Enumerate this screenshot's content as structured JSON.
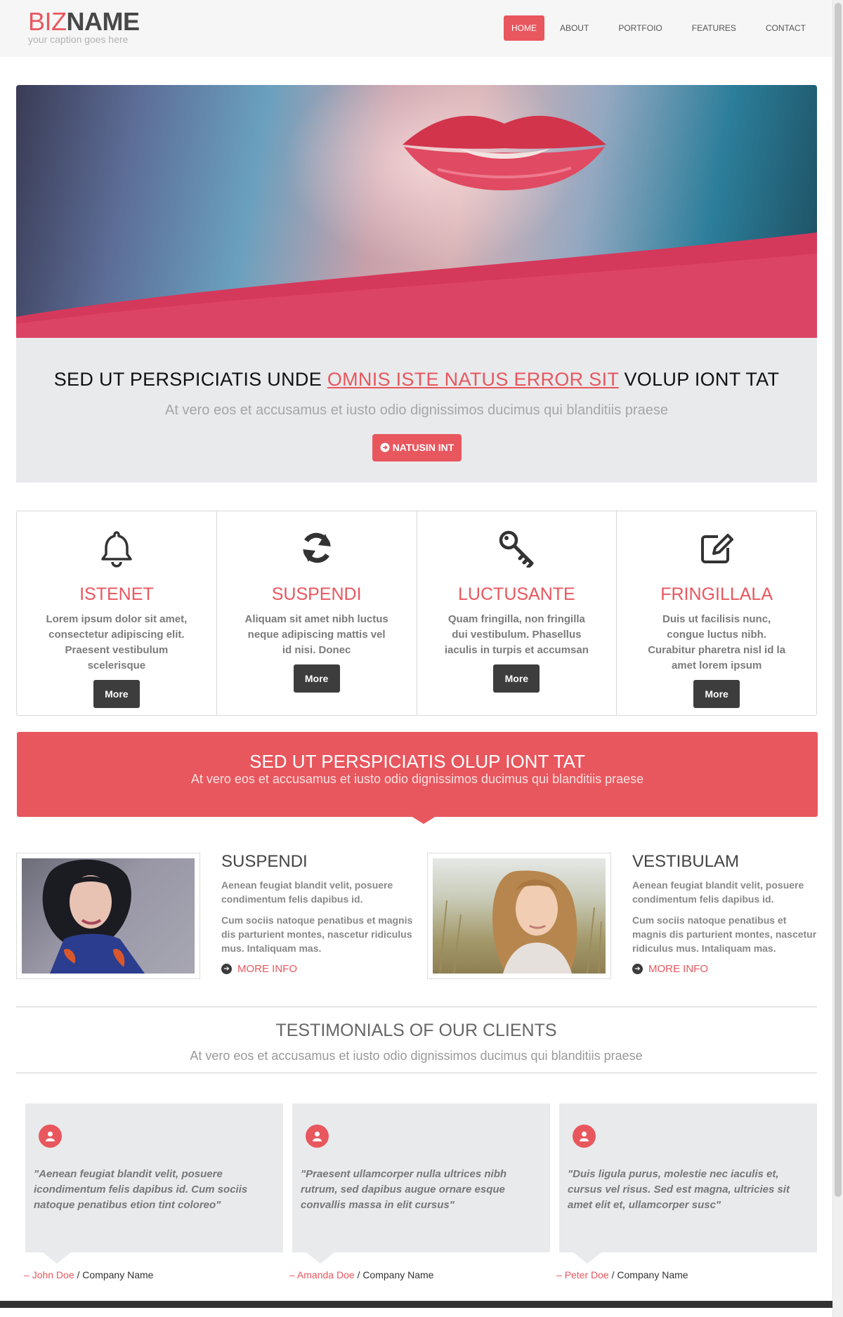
{
  "brand": {
    "logo_part1": "BIZ",
    "logo_part2": "NAME",
    "caption": "your caption goes here"
  },
  "nav": {
    "items": [
      "HOME",
      "ABOUT",
      "PORTFOIO",
      "FEATURES",
      "CONTACT"
    ],
    "active": "HOME"
  },
  "intro": {
    "headline_pre": "SED UT PERSPICIATIS UNDE",
    "headline_highlight": "OMNIS ISTE NATUS ERROR SIT",
    "headline_post": "VOLUP IONT TAT",
    "subtitle": "At vero eos et accusamus et iusto odio dignissimos ducimus qui blanditiis praese",
    "button_icon": "circle-arrow-right-icon",
    "button_label": "NATUSIN INT"
  },
  "features": [
    {
      "icon": "bell-icon",
      "title": "ISTENET",
      "text": "Lorem ipsum dolor sit amet, consectetur adipiscing elit. Praesent vestibulum scelerisque",
      "button": "More"
    },
    {
      "icon": "refresh-icon",
      "title": "SUSPENDI",
      "text": "Aliquam sit amet nibh luctus neque adipiscing mattis vel id nisi. Donec",
      "button": "More"
    },
    {
      "icon": "key-icon",
      "title": "LUCTUSANTE",
      "text": "Quam fringilla, non fringilla dui vestibulum. Phasellus iaculis in turpis et accumsan",
      "button": "More"
    },
    {
      "icon": "edit-icon",
      "title": "FRINGILLALA",
      "text": "Duis ut facilisis nunc, congue luctus nibh. Curabitur pharetra nisl id la amet lorem ipsum",
      "button": "More"
    }
  ],
  "banner": {
    "title": "SED UT PERSPICIATIS OLUP IONT TAT",
    "subtitle": "At vero eos et accusamus et iusto odio dignissimos ducimus qui blanditiis praese"
  },
  "profiles": [
    {
      "title": "SUSPENDI",
      "para1": "Aenean feugiat blandit velit, posuere condimentum felis dapibus id.",
      "para2": "Cum sociis natoque penatibus et magnis dis parturient montes, nascetur ridiculus mus. Intaliquam mas.",
      "link": "MORE INFO"
    },
    {
      "title": "VESTIBULAM",
      "para1": "Aenean feugiat blandit velit, posuere condimentum felis dapibus id.",
      "para2": "Cum sociis natoque penatibus et magnis dis parturient montes, nascetur ridiculus mus. Intaliquam mas.",
      "link": "MORE INFO"
    }
  ],
  "testimonials": {
    "title": "TESTIMONIALS OF OUR CLIENTS",
    "subtitle": "At vero eos et accusamus et iusto odio dignissimos ducimus qui blanditiis praese",
    "items": [
      {
        "quote": "\"Aenean feugiat blandit velit, posuere icondimentum felis dapibus id. Cum sociis natoque penatibus etion tint coloreo\"",
        "dash": "–",
        "name": "John Doe",
        "sep": "/",
        "company": "Company Name"
      },
      {
        "quote": "\"Praesent ullamcorper nulla ultrices nibh rutrum, sed dapibus augue ornare esque convallis massa in elit cursus\"",
        "dash": "–",
        "name": "Amanda Doe",
        "sep": "/",
        "company": "Company Name"
      },
      {
        "quote": "\"Duis ligula purus, molestie nec iaculis et, cursus vel risus. Sed est magna, ultricies sit amet elit et, ullamcorper susc\"",
        "dash": "–",
        "name": "Peter Doe",
        "sep": "/",
        "company": "Company Name"
      }
    ]
  },
  "colors": {
    "accent": "#e8575e",
    "dark_button": "#3d3d3d",
    "band": "#e9eaec"
  }
}
